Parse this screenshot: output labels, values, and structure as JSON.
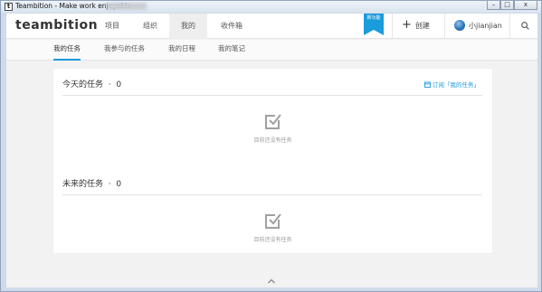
{
  "window": {
    "title": "Teambition - Make work enjoyable",
    "icon_letter": "t",
    "buttons": [
      "–",
      "□",
      "x"
    ]
  },
  "topnav": {
    "logo": "teambition",
    "items": [
      "项目",
      "组织",
      "我的",
      "收件箱"
    ],
    "active_index": 2,
    "badge": "新功能",
    "create_label": "创建",
    "user_name": "小jianjian"
  },
  "subnav": {
    "items": [
      "我的任务",
      "我参与的任务",
      "我的日程",
      "我的笔记"
    ],
    "active_index": 0
  },
  "today": {
    "title": "今天的任务",
    "separator": "·",
    "count": "0",
    "subscribe_label": "订阅「我的任务」",
    "empty_text": "目前还没有任务"
  },
  "future": {
    "title": "未来的任务",
    "separator": "·",
    "count": "0",
    "empty_text": "目前还没有任务"
  },
  "colors": {
    "accent": "#1a9bdb",
    "icon_gray": "#a0a0a0"
  },
  "icons": [
    "search-icon",
    "plus-icon",
    "calendar-icon",
    "checkbox-icon",
    "chevron-up-icon"
  ]
}
